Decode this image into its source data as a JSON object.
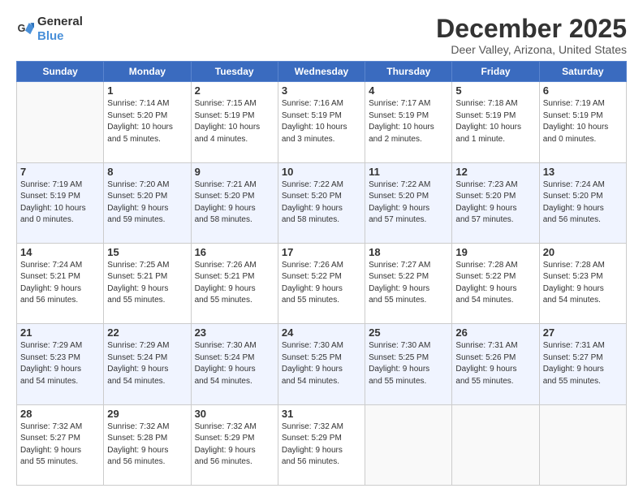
{
  "logo": {
    "general": "General",
    "blue": "Blue"
  },
  "title": "December 2025",
  "location": "Deer Valley, Arizona, United States",
  "days_header": [
    "Sunday",
    "Monday",
    "Tuesday",
    "Wednesday",
    "Thursday",
    "Friday",
    "Saturday"
  ],
  "weeks": [
    [
      {
        "num": "",
        "info": ""
      },
      {
        "num": "1",
        "info": "Sunrise: 7:14 AM\nSunset: 5:20 PM\nDaylight: 10 hours\nand 5 minutes."
      },
      {
        "num": "2",
        "info": "Sunrise: 7:15 AM\nSunset: 5:19 PM\nDaylight: 10 hours\nand 4 minutes."
      },
      {
        "num": "3",
        "info": "Sunrise: 7:16 AM\nSunset: 5:19 PM\nDaylight: 10 hours\nand 3 minutes."
      },
      {
        "num": "4",
        "info": "Sunrise: 7:17 AM\nSunset: 5:19 PM\nDaylight: 10 hours\nand 2 minutes."
      },
      {
        "num": "5",
        "info": "Sunrise: 7:18 AM\nSunset: 5:19 PM\nDaylight: 10 hours\nand 1 minute."
      },
      {
        "num": "6",
        "info": "Sunrise: 7:19 AM\nSunset: 5:19 PM\nDaylight: 10 hours\nand 0 minutes."
      }
    ],
    [
      {
        "num": "7",
        "info": "Sunrise: 7:19 AM\nSunset: 5:19 PM\nDaylight: 10 hours\nand 0 minutes."
      },
      {
        "num": "8",
        "info": "Sunrise: 7:20 AM\nSunset: 5:20 PM\nDaylight: 9 hours\nand 59 minutes."
      },
      {
        "num": "9",
        "info": "Sunrise: 7:21 AM\nSunset: 5:20 PM\nDaylight: 9 hours\nand 58 minutes."
      },
      {
        "num": "10",
        "info": "Sunrise: 7:22 AM\nSunset: 5:20 PM\nDaylight: 9 hours\nand 58 minutes."
      },
      {
        "num": "11",
        "info": "Sunrise: 7:22 AM\nSunset: 5:20 PM\nDaylight: 9 hours\nand 57 minutes."
      },
      {
        "num": "12",
        "info": "Sunrise: 7:23 AM\nSunset: 5:20 PM\nDaylight: 9 hours\nand 57 minutes."
      },
      {
        "num": "13",
        "info": "Sunrise: 7:24 AM\nSunset: 5:20 PM\nDaylight: 9 hours\nand 56 minutes."
      }
    ],
    [
      {
        "num": "14",
        "info": "Sunrise: 7:24 AM\nSunset: 5:21 PM\nDaylight: 9 hours\nand 56 minutes."
      },
      {
        "num": "15",
        "info": "Sunrise: 7:25 AM\nSunset: 5:21 PM\nDaylight: 9 hours\nand 55 minutes."
      },
      {
        "num": "16",
        "info": "Sunrise: 7:26 AM\nSunset: 5:21 PM\nDaylight: 9 hours\nand 55 minutes."
      },
      {
        "num": "17",
        "info": "Sunrise: 7:26 AM\nSunset: 5:22 PM\nDaylight: 9 hours\nand 55 minutes."
      },
      {
        "num": "18",
        "info": "Sunrise: 7:27 AM\nSunset: 5:22 PM\nDaylight: 9 hours\nand 55 minutes."
      },
      {
        "num": "19",
        "info": "Sunrise: 7:28 AM\nSunset: 5:22 PM\nDaylight: 9 hours\nand 54 minutes."
      },
      {
        "num": "20",
        "info": "Sunrise: 7:28 AM\nSunset: 5:23 PM\nDaylight: 9 hours\nand 54 minutes."
      }
    ],
    [
      {
        "num": "21",
        "info": "Sunrise: 7:29 AM\nSunset: 5:23 PM\nDaylight: 9 hours\nand 54 minutes."
      },
      {
        "num": "22",
        "info": "Sunrise: 7:29 AM\nSunset: 5:24 PM\nDaylight: 9 hours\nand 54 minutes."
      },
      {
        "num": "23",
        "info": "Sunrise: 7:30 AM\nSunset: 5:24 PM\nDaylight: 9 hours\nand 54 minutes."
      },
      {
        "num": "24",
        "info": "Sunrise: 7:30 AM\nSunset: 5:25 PM\nDaylight: 9 hours\nand 54 minutes."
      },
      {
        "num": "25",
        "info": "Sunrise: 7:30 AM\nSunset: 5:25 PM\nDaylight: 9 hours\nand 55 minutes."
      },
      {
        "num": "26",
        "info": "Sunrise: 7:31 AM\nSunset: 5:26 PM\nDaylight: 9 hours\nand 55 minutes."
      },
      {
        "num": "27",
        "info": "Sunrise: 7:31 AM\nSunset: 5:27 PM\nDaylight: 9 hours\nand 55 minutes."
      }
    ],
    [
      {
        "num": "28",
        "info": "Sunrise: 7:32 AM\nSunset: 5:27 PM\nDaylight: 9 hours\nand 55 minutes."
      },
      {
        "num": "29",
        "info": "Sunrise: 7:32 AM\nSunset: 5:28 PM\nDaylight: 9 hours\nand 56 minutes."
      },
      {
        "num": "30",
        "info": "Sunrise: 7:32 AM\nSunset: 5:29 PM\nDaylight: 9 hours\nand 56 minutes."
      },
      {
        "num": "31",
        "info": "Sunrise: 7:32 AM\nSunset: 5:29 PM\nDaylight: 9 hours\nand 56 minutes."
      },
      {
        "num": "",
        "info": ""
      },
      {
        "num": "",
        "info": ""
      },
      {
        "num": "",
        "info": ""
      }
    ]
  ]
}
